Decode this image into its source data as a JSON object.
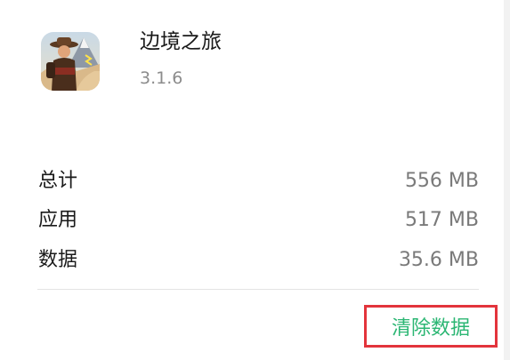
{
  "app": {
    "name": "边境之旅",
    "version": "3.1.6"
  },
  "storage": {
    "rows": [
      {
        "label": "总计",
        "value": "556 MB"
      },
      {
        "label": "应用",
        "value": "517 MB"
      },
      {
        "label": "数据",
        "value": "35.6 MB"
      }
    ]
  },
  "actions": {
    "clear_data_label": "清除数据"
  },
  "colors": {
    "accent_green": "#2bb673",
    "highlight_red": "#e3343c"
  }
}
